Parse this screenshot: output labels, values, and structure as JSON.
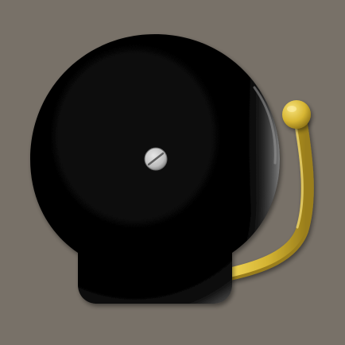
{
  "app": {
    "icon_name": "school-bell-icon"
  },
  "colors": {
    "background": "#787168",
    "bell_body": "#000000",
    "bell_rim_highlight": "#5a5a5a",
    "striker_arm": "#d9b93a",
    "striker_shadow": "#9a7e1c",
    "screw_head": "#c8c8c8",
    "screw_slot": "#5e5e5e"
  }
}
